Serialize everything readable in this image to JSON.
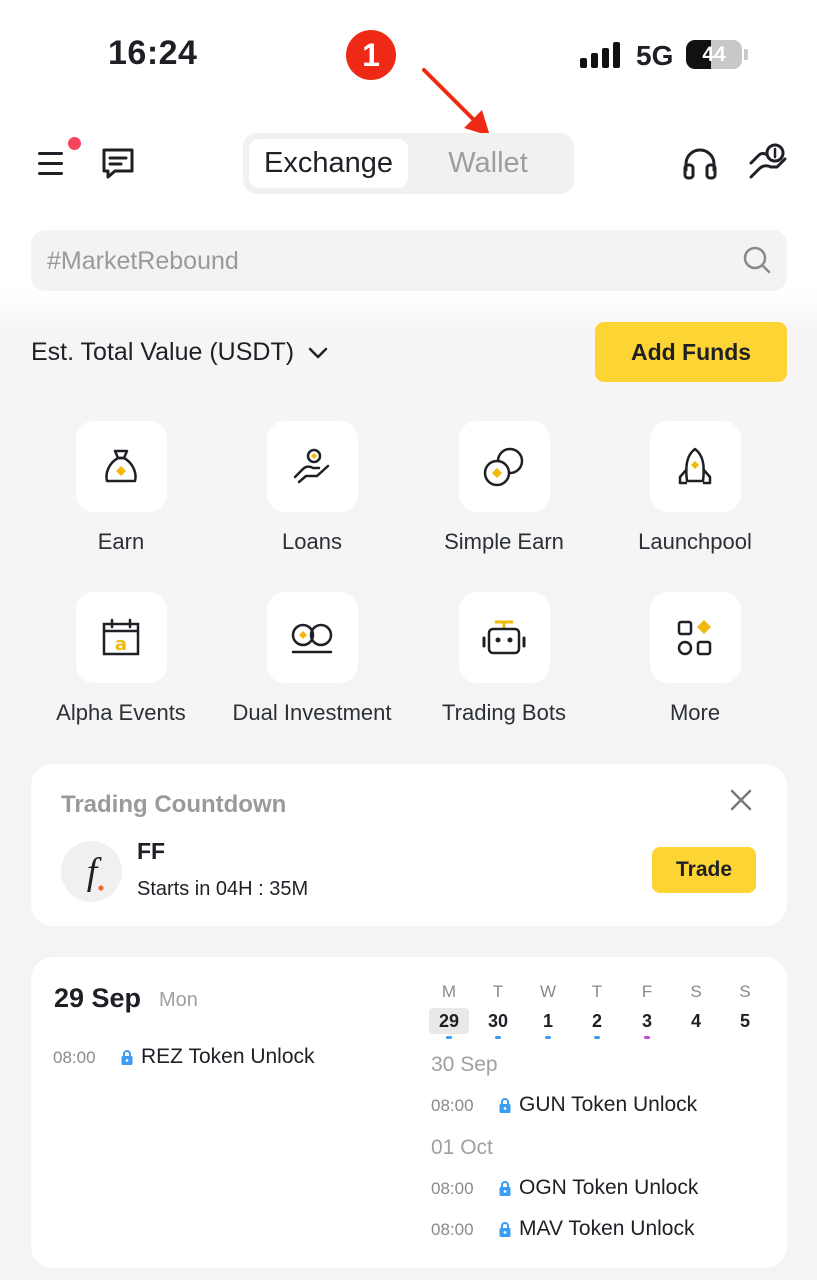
{
  "status_bar": {
    "time": "16:24",
    "network": "5G",
    "battery": "44",
    "battery_level": 0.44
  },
  "annotation": {
    "badge": "1"
  },
  "nav": {
    "tabs": [
      {
        "label": "Exchange",
        "active": true
      },
      {
        "label": "Wallet",
        "active": false
      }
    ]
  },
  "search": {
    "placeholder": "#MarketRebound"
  },
  "balance": {
    "label": "Est. Total Value (USDT)",
    "add_funds": "Add Funds"
  },
  "shortcuts": [
    {
      "label": "Earn",
      "icon": "money-bag-icon"
    },
    {
      "label": "Loans",
      "icon": "hand-coin-icon"
    },
    {
      "label": "Simple Earn",
      "icon": "coins-icon"
    },
    {
      "label": "Launchpool",
      "icon": "rocket-icon"
    },
    {
      "label": "Alpha Events",
      "icon": "calendar-icon"
    },
    {
      "label": "Dual Investment",
      "icon": "dual-coins-icon"
    },
    {
      "label": "Trading Bots",
      "icon": "robot-icon"
    },
    {
      "label": "More",
      "icon": "grid-more-icon"
    }
  ],
  "countdown": {
    "title": "Trading Countdown",
    "token": "FF",
    "starts_label": "Starts in",
    "starts_value": "04H : 35M",
    "trade": "Trade"
  },
  "calendar": {
    "date": "29 Sep",
    "weekday": "Mon",
    "week": [
      {
        "letter": "M",
        "day": "29",
        "today": true,
        "dot": "#3b9cf3"
      },
      {
        "letter": "T",
        "day": "30",
        "dot": "#3b9cf3"
      },
      {
        "letter": "W",
        "day": "1",
        "dot": "#3b9cf3"
      },
      {
        "letter": "T",
        "day": "2",
        "dot": "#3b9cf3"
      },
      {
        "letter": "F",
        "day": "3",
        "dot": "#c44de0"
      },
      {
        "letter": "S",
        "day": "4",
        "dot": null
      },
      {
        "letter": "S",
        "day": "5",
        "dot": null
      }
    ],
    "today_events": [
      {
        "time": "08:00",
        "name": "REZ Token Unlock"
      }
    ],
    "upcoming": [
      {
        "date": "30 Sep",
        "events": [
          {
            "time": "08:00",
            "name": "GUN Token Unlock"
          }
        ]
      },
      {
        "date": "01 Oct",
        "events": [
          {
            "time": "08:00",
            "name": "OGN Token Unlock"
          },
          {
            "time": "08:00",
            "name": "MAV Token Unlock"
          }
        ]
      }
    ]
  },
  "colors": {
    "accent": "#fcd535",
    "notification": "#f6465d",
    "annotation": "#ee2a16",
    "lock": "#3b9cf3"
  }
}
